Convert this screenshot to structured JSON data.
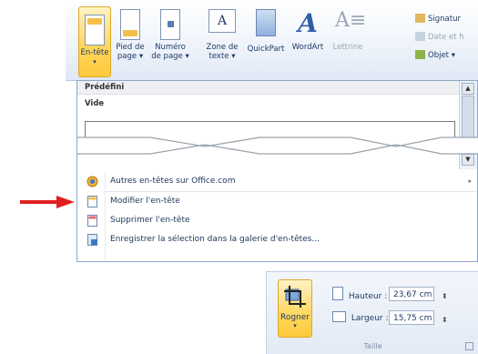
{
  "ribbon": {
    "buttons": [
      {
        "label": "En-tête",
        "arrow": "▾"
      },
      {
        "label": "Pied de page",
        "line1": "Pied de",
        "line2": "page ▾"
      },
      {
        "label": "Numéro de page",
        "line1": "Numéro",
        "line2": "de page ▾"
      },
      {
        "label": "Zone de texte",
        "line1": "Zone de",
        "line2": "texte ▾"
      },
      {
        "label": "QuickPart"
      },
      {
        "label": "WordArt"
      },
      {
        "label": "Lettrine"
      }
    ],
    "right_items": [
      "Signatur",
      "Date et h",
      "Objet ▾"
    ]
  },
  "gallery": {
    "section": "Prédéfini",
    "item": "Vide"
  },
  "menu": {
    "items": [
      {
        "label": "Autres en-têtes sur Office.com",
        "submenu": "▸"
      },
      {
        "label": "Modifier l'en-tête"
      },
      {
        "label": "Supprimer l'en-tête"
      },
      {
        "label": "Enregistrer la sélection dans la galerie d'en-têtes..."
      }
    ]
  },
  "size_panel": {
    "crop_label": "Rogner",
    "height_label": "Hauteur :",
    "height_value": "23,67 cm",
    "width_label": "Largeur :",
    "width_value": "15,75 cm",
    "group_label": "Taille"
  },
  "colors": {
    "accent_active": "#ffd760",
    "ribbon_text": "#1f3a66",
    "arrow_red": "#e02020"
  }
}
